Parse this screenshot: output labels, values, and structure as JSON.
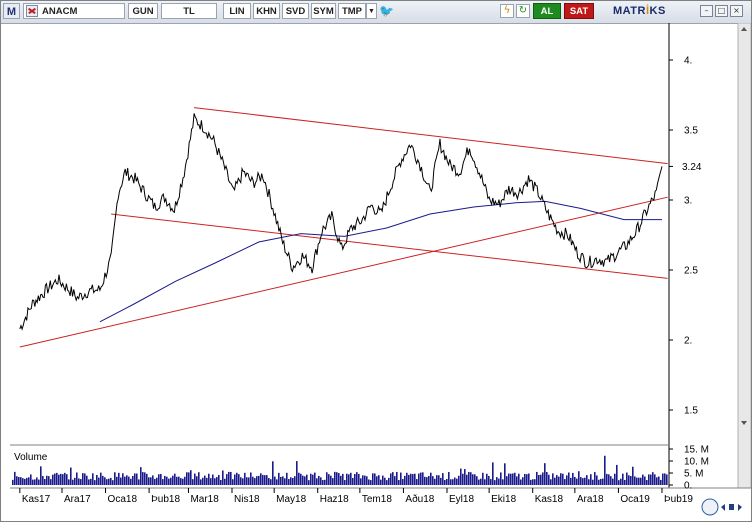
{
  "toolbar": {
    "logo": "M",
    "symbol": "ANACM",
    "period": "GUN",
    "currency": "TL",
    "scale": "LIN",
    "buttons": [
      "KHN",
      "SVD",
      "SYM",
      "TMP"
    ],
    "buy_label": "AL",
    "sell_label": "SAT",
    "brand_pre": "MATR",
    "brand_i": "İ",
    "brand_post": "KS",
    "icons": [
      "dropdown-icon",
      "twitter-icon",
      "bolt-icon",
      "refresh-icon",
      "minimize-icon",
      "maximize-icon",
      "close-icon"
    ]
  },
  "chart_data": {
    "type": "line",
    "series": [
      {
        "kind": "price",
        "color": "#000000",
        "points": [
          [
            "2017-11-01",
            2.08
          ],
          [
            "2017-11-10",
            2.26
          ],
          [
            "2017-11-20",
            2.36
          ],
          [
            "2017-11-28",
            2.43
          ],
          [
            "2017-12-05",
            2.37
          ],
          [
            "2017-12-12",
            2.3
          ],
          [
            "2017-12-20",
            2.35
          ],
          [
            "2017-12-28",
            2.36
          ],
          [
            "2018-01-05",
            2.58
          ],
          [
            "2018-01-10",
            3.05
          ],
          [
            "2018-01-15",
            3.2
          ],
          [
            "2018-01-22",
            3.15
          ],
          [
            "2018-01-29",
            3.05
          ],
          [
            "2018-02-05",
            2.95
          ],
          [
            "2018-02-12",
            3.02
          ],
          [
            "2018-02-19",
            2.93
          ],
          [
            "2018-02-26",
            3.2
          ],
          [
            "2018-03-05",
            3.58
          ],
          [
            "2018-03-12",
            3.52
          ],
          [
            "2018-03-19",
            3.42
          ],
          [
            "2018-03-26",
            3.25
          ],
          [
            "2018-04-02",
            3.05
          ],
          [
            "2018-04-09",
            3.2
          ],
          [
            "2018-04-16",
            3.12
          ],
          [
            "2018-04-23",
            3.18
          ],
          [
            "2018-04-30",
            2.95
          ],
          [
            "2018-05-07",
            2.7
          ],
          [
            "2018-05-14",
            2.52
          ],
          [
            "2018-05-21",
            2.6
          ],
          [
            "2018-05-28",
            2.52
          ],
          [
            "2018-06-04",
            2.78
          ],
          [
            "2018-06-11",
            2.88
          ],
          [
            "2018-06-18",
            2.65
          ],
          [
            "2018-06-25",
            2.8
          ],
          [
            "2018-07-02",
            2.85
          ],
          [
            "2018-07-09",
            2.96
          ],
          [
            "2018-07-16",
            2.9
          ],
          [
            "2018-07-23",
            3.1
          ],
          [
            "2018-07-30",
            3.28
          ],
          [
            "2018-08-06",
            3.4
          ],
          [
            "2018-08-13",
            3.25
          ],
          [
            "2018-08-20",
            3.05
          ],
          [
            "2018-08-27",
            3.4
          ],
          [
            "2018-09-03",
            3.25
          ],
          [
            "2018-09-10",
            3.2
          ],
          [
            "2018-09-17",
            3.38
          ],
          [
            "2018-09-24",
            3.2
          ],
          [
            "2018-10-01",
            3.0
          ],
          [
            "2018-10-08",
            2.97
          ],
          [
            "2018-10-15",
            3.08
          ],
          [
            "2018-10-22",
            3.05
          ],
          [
            "2018-10-29",
            3.15
          ],
          [
            "2018-11-05",
            3.05
          ],
          [
            "2018-11-12",
            2.9
          ],
          [
            "2018-11-19",
            2.78
          ],
          [
            "2018-11-26",
            2.75
          ],
          [
            "2018-12-03",
            2.62
          ],
          [
            "2018-12-10",
            2.55
          ],
          [
            "2018-12-17",
            2.58
          ],
          [
            "2018-12-24",
            2.56
          ],
          [
            "2018-12-31",
            2.62
          ],
          [
            "2019-01-07",
            2.68
          ],
          [
            "2019-01-14",
            2.78
          ],
          [
            "2019-01-21",
            2.92
          ],
          [
            "2019-01-28",
            3.05
          ],
          [
            "2019-02-01",
            3.24
          ]
        ]
      },
      {
        "kind": "moving-average",
        "color": "#1a1a8c",
        "points": [
          [
            "2017-12-28",
            2.13
          ],
          [
            "2018-01-20",
            2.25
          ],
          [
            "2018-02-20",
            2.42
          ],
          [
            "2018-03-20",
            2.55
          ],
          [
            "2018-04-20",
            2.7
          ],
          [
            "2018-05-20",
            2.76
          ],
          [
            "2018-06-20",
            2.74
          ],
          [
            "2018-07-20",
            2.8
          ],
          [
            "2018-08-20",
            2.9
          ],
          [
            "2018-09-20",
            2.95
          ],
          [
            "2018-10-20",
            2.98
          ],
          [
            "2018-11-10",
            2.99
          ],
          [
            "2018-12-05",
            2.94
          ],
          [
            "2019-01-05",
            2.86
          ],
          [
            "2019-02-01",
            2.86
          ]
        ]
      }
    ],
    "trendlines": [
      {
        "color": "#cc2222",
        "from": [
          "2018-01-05",
          2.9
        ],
        "to": [
          "2019-02-05",
          2.44
        ]
      },
      {
        "color": "#cc2222",
        "from": [
          "2018-03-05",
          3.66
        ],
        "to": [
          "2019-02-05",
          3.26
        ]
      },
      {
        "color": "#cc2222",
        "from": [
          "2017-11-01",
          1.95
        ],
        "to": [
          "2019-02-05",
          3.02
        ]
      }
    ],
    "last_value": "3.24",
    "x_axis": {
      "range": [
        "2017-10-25",
        "2019-02-06"
      ],
      "tick_labels": [
        "Kas17",
        "Ara17",
        "Oca18",
        "Þub18",
        "Mar18",
        "Nis18",
        "May18",
        "Haz18",
        "Tem18",
        "Aðu18",
        "Eyl18",
        "Eki18",
        "Kas18",
        "Ara18",
        "Oca19",
        "Þub19"
      ],
      "tick_dates": [
        "2017-11-01",
        "2017-12-01",
        "2018-01-01",
        "2018-02-01",
        "2018-03-01",
        "2018-04-01",
        "2018-05-01",
        "2018-06-01",
        "2018-07-01",
        "2018-08-01",
        "2018-09-01",
        "2018-10-01",
        "2018-11-01",
        "2018-12-01",
        "2019-01-01",
        "2019-02-01"
      ]
    },
    "y_axis": {
      "scale": "linear",
      "range": [
        1.25,
        4.25
      ],
      "tick_values": [
        4.0,
        3.5,
        3.0,
        2.5,
        2.0,
        1.5
      ],
      "tick_labels": [
        "4.",
        "3.5",
        "3.",
        "2.5",
        "2.",
        "1.5"
      ]
    },
    "volume": {
      "title": "Volume",
      "axis_labels": [
        "15. M",
        "10. M",
        "5. M",
        "0."
      ],
      "axis_values": [
        15000000,
        10000000,
        5000000,
        0
      ]
    },
    "grid": false
  }
}
